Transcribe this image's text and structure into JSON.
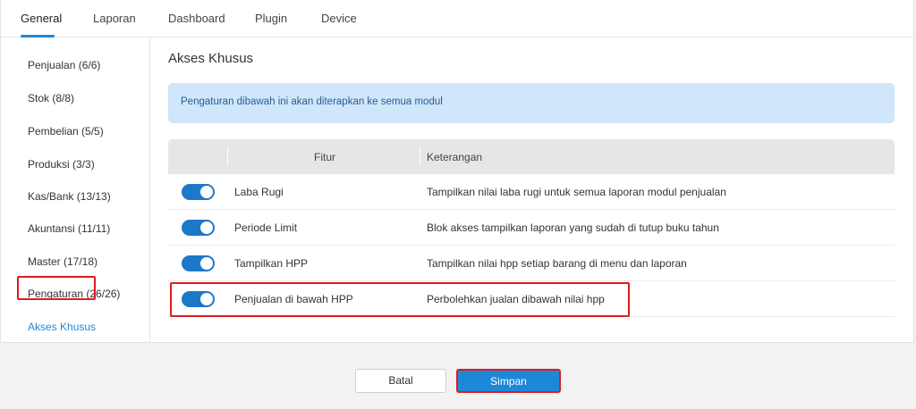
{
  "tabs": [
    {
      "label": "General",
      "active": true
    },
    {
      "label": "Laporan"
    },
    {
      "label": "Dashboard"
    },
    {
      "label": "Plugin"
    },
    {
      "label": "Device"
    }
  ],
  "sidebar": {
    "items": [
      {
        "label": "Penjualan (6/6)"
      },
      {
        "label": "Stok (8/8)"
      },
      {
        "label": "Pembelian (5/5)"
      },
      {
        "label": "Produksi (3/3)"
      },
      {
        "label": "Kas/Bank (13/13)"
      },
      {
        "label": "Akuntansi (11/11)"
      },
      {
        "label": "Master (17/18)"
      },
      {
        "label": "Pengaturan (26/26)"
      },
      {
        "label": "Akses Khusus",
        "active": true
      }
    ]
  },
  "content": {
    "title": "Akses Khusus",
    "info": "Pengaturan dibawah ini akan diterapkan ke semua modul"
  },
  "table": {
    "headers": {
      "fitur": "Fitur",
      "keterangan": "Keterangan"
    },
    "rows": [
      {
        "enabled": true,
        "fitur": "Laba Rugi",
        "keterangan": "Tampilkan nilai laba rugi untuk semua laporan modul penjualan"
      },
      {
        "enabled": true,
        "fitur": "Periode Limit",
        "keterangan": "Blok akses tampilkan laporan yang sudah di tutup buku tahun"
      },
      {
        "enabled": true,
        "fitur": "Tampilkan HPP",
        "keterangan": "Tampilkan nilai hpp setiap barang di menu dan laporan"
      },
      {
        "enabled": true,
        "fitur": "Penjualan di bawah HPP",
        "keterangan": "Perbolehkan jualan dibawah nilai hpp"
      }
    ]
  },
  "footer": {
    "cancel_label": "Batal",
    "save_label": "Simpan"
  },
  "colors": {
    "accent": "#1e88d8",
    "toggle_on": "#1e78c8",
    "highlight": "#e01a22",
    "info_bg": "#cfe6fb"
  }
}
